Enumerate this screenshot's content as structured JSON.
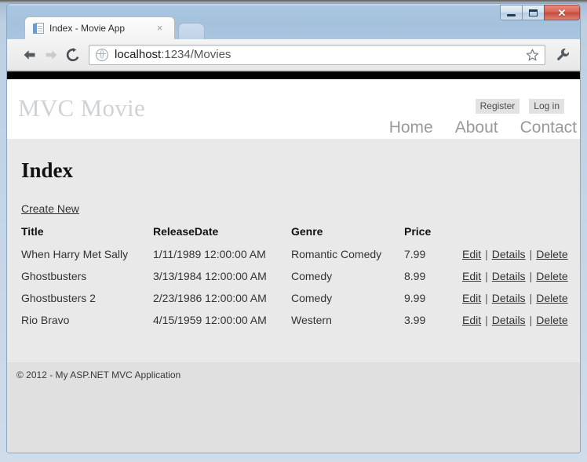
{
  "browser": {
    "tab": {
      "title": "Index - Movie App",
      "close_label": "×",
      "favicon_name": "page-icon"
    },
    "new_tab_label": "",
    "toolbar": {
      "back_label": "Back",
      "forward_label": "Forward",
      "reload_label": "Reload",
      "url_scheme_host": "localhost",
      "url_rest": ":1234/Movies",
      "url_full": "localhost:1234/Movies",
      "star_label": "Bookmark this page",
      "wrench_label": "Customize and control"
    },
    "window_controls": {
      "minimize": "–",
      "maximize": "□",
      "close": "✕"
    }
  },
  "site": {
    "brand": "MVC Movie",
    "account": [
      {
        "label": "Register"
      },
      {
        "label": "Log in"
      }
    ],
    "nav": [
      {
        "label": "Home"
      },
      {
        "label": "About"
      },
      {
        "label": "Contact"
      }
    ],
    "page_title": "Index",
    "create_new_label": "Create New",
    "table": {
      "headers": [
        "Title",
        "ReleaseDate",
        "Genre",
        "Price",
        ""
      ],
      "rows": [
        {
          "title": "When Harry Met Sally",
          "release_date": "1/11/1989 12:00:00 AM",
          "genre": "Romantic Comedy",
          "price": "7.99",
          "actions": [
            "Edit",
            "Details",
            "Delete"
          ]
        },
        {
          "title": "Ghostbusters",
          "release_date": "3/13/1984 12:00:00 AM",
          "genre": "Comedy",
          "price": "8.99",
          "actions": [
            "Edit",
            "Details",
            "Delete"
          ]
        },
        {
          "title": "Ghostbusters 2",
          "release_date": "2/23/1986 12:00:00 AM",
          "genre": "Comedy",
          "price": "9.99",
          "actions": [
            "Edit",
            "Details",
            "Delete"
          ]
        },
        {
          "title": "Rio Bravo",
          "release_date": "4/15/1959 12:00:00 AM",
          "genre": "Western",
          "price": "3.99",
          "actions": [
            "Edit",
            "Details",
            "Delete"
          ]
        }
      ],
      "action_separator": "|"
    },
    "footer": "© 2012 - My ASP.NET MVC Application"
  },
  "colors": {
    "titlebar": "#a9c5e0",
    "close_button": "#c44a3c",
    "site_topbar": "#000000",
    "brand_text": "#cfd2d6",
    "body_bg": "#e9e9e9",
    "footer_bg": "#e0e0e0",
    "nav_text": "#999999"
  }
}
